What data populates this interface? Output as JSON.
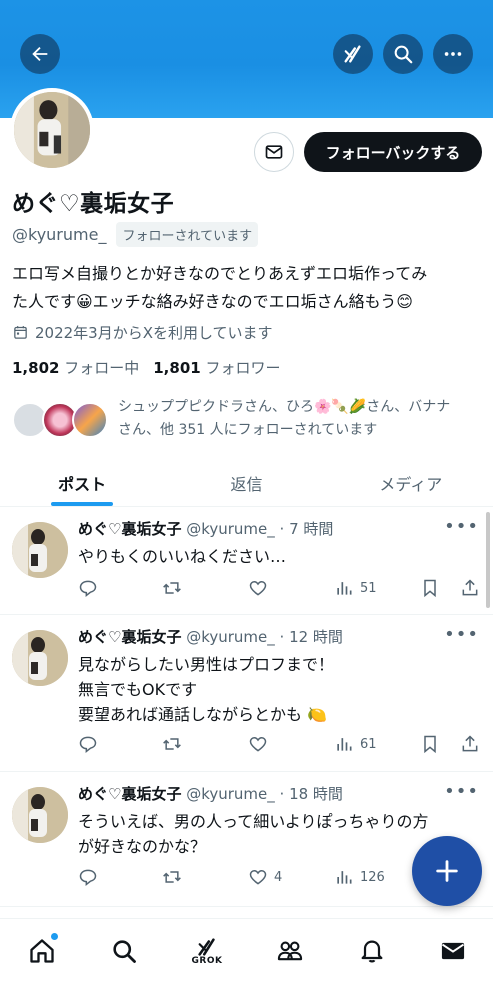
{
  "header": {
    "back_icon": "arrow-left-icon",
    "grok_icon": "grok-icon",
    "search_icon": "search-icon",
    "more_icon": "more-horizontal-icon",
    "banner_color": "#1d93e6"
  },
  "profile": {
    "display_name": "めぐ♡裏垢女子",
    "handle": "@kyurume_",
    "follows_you": "フォローされています",
    "message_icon": "mail-icon",
    "follow_back_label": "フォローバックする",
    "bio_line1": "エロ写メ自撮りとか好きなのでとりあえずエロ垢作ってみ",
    "bio_line2": "た人です😀エッチな絡み好きなのでエロ垢さん絡もう😊",
    "joined": "2022年3月からXを利用しています",
    "following_count": "1,802",
    "following_label": "フォロー中",
    "followers_count": "1,801",
    "followers_label": "フォロワー",
    "mutuals_line1": "シュッププピクドラさん、ひろ🌸🍡🌽さん、バナナ",
    "mutuals_line2": "さん、他 351 人にフォローされています"
  },
  "tabs": [
    {
      "label": "ポスト",
      "active": true
    },
    {
      "label": "返信",
      "active": false
    },
    {
      "label": "メディア",
      "active": false
    }
  ],
  "posts": [
    {
      "name": "めぐ♡裏垢女子",
      "meta": " @kyurume_ · 7 時間",
      "text": "やりもくのいいねください…",
      "replies": "",
      "reposts": "",
      "likes": "",
      "views": "51"
    },
    {
      "name": "めぐ♡裏垢女子",
      "meta": " @kyurume_ · 12 時間",
      "text": "見ながらしたい男性はプロフまで！\n無言でもOKです\n要望あれば通話しながらとかも 🍋",
      "replies": "",
      "reposts": "",
      "likes": "",
      "views": "61"
    },
    {
      "name": "めぐ♡裏垢女子",
      "meta": " @kyurume_ · 18 時間",
      "text": "そういえば、男の人って細いよりぽっちゃりの方\nが好きなのかな？",
      "replies": "",
      "reposts": "",
      "likes": "4",
      "views": "126"
    }
  ],
  "more_dots": "•••",
  "fab": {
    "icon": "plus-icon",
    "color": "#1f4fa6"
  },
  "bottom_nav": {
    "home_icon": "home-icon",
    "search_icon": "search-icon",
    "grok_label": "GROK",
    "communities_icon": "people-icon",
    "notifications_icon": "bell-icon",
    "messages_icon": "mail-icon"
  },
  "colors": {
    "accent": "#1d9bf0",
    "text": "#0f1419",
    "muted": "#536471"
  }
}
